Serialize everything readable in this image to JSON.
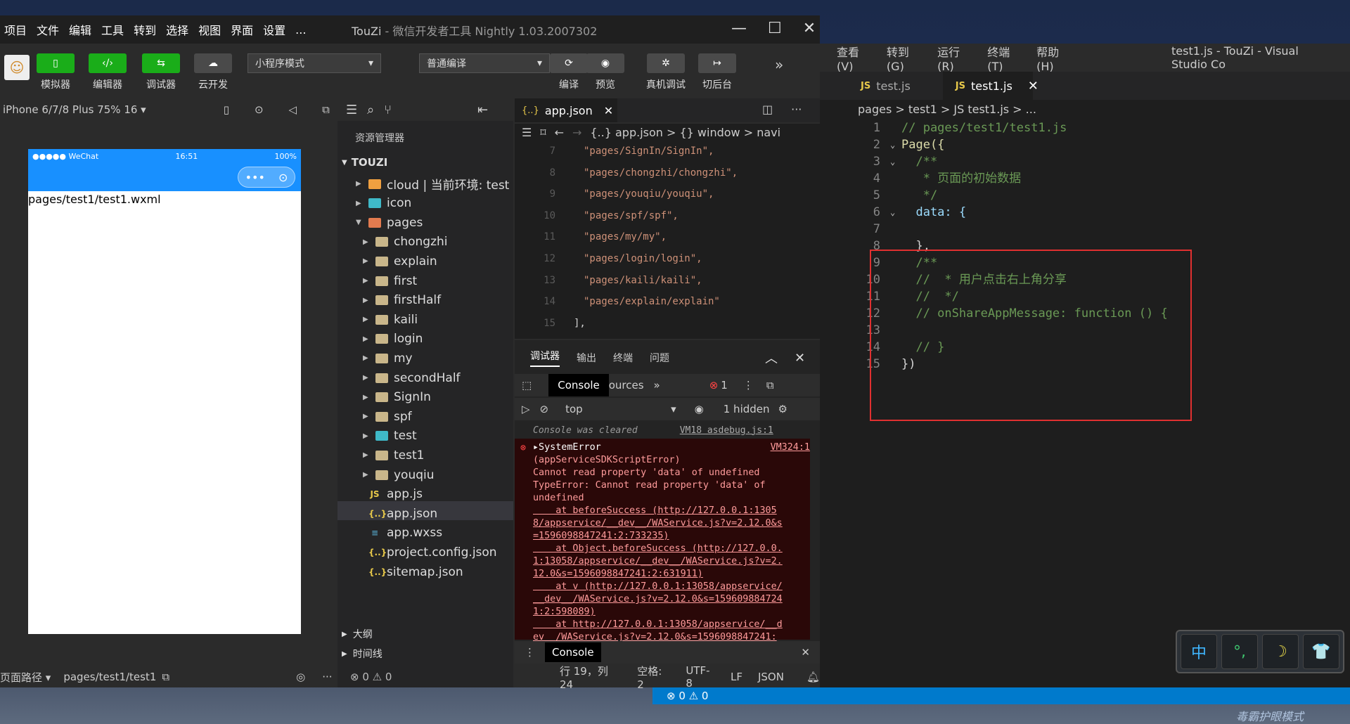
{
  "wx_menu": [
    "项目",
    "文件",
    "编辑",
    "工具",
    "转到",
    "选择",
    "视图",
    "界面",
    "设置",
    "..."
  ],
  "wx_title": {
    "app": "TouZi",
    "sub": " - 微信开发者工具 Nightly 1.03.2007302"
  },
  "toolbar": {
    "simulator": "模拟器",
    "editor": "编辑器",
    "debugger": "调试器",
    "cloud": "云开发",
    "mode": "小程序模式",
    "compile_mode": "普通编译",
    "compile": "编译",
    "preview": "预览",
    "real_debug": "真机调试",
    "backend": "切后台"
  },
  "simulator": {
    "device": "iPhone 6/7/8 Plus 75% 16 ▾",
    "carrier": "●●●●● WeChat",
    "time": "16:51",
    "battery": "100%",
    "page_text": "pages/test1/test1.wxml",
    "footer_label": "页面路径 ▾",
    "footer_path": "pages/test1/test1"
  },
  "explorer": {
    "title": "资源管理器",
    "root": "TOUZI",
    "items": [
      "cloud | 当前环境: test",
      "icon",
      "pages",
      "chongzhi",
      "explain",
      "first",
      "firstHalf",
      "kaili",
      "login",
      "my",
      "secondHalf",
      "SignIn",
      "spf",
      "test",
      "test1",
      "youqiu",
      "app.js",
      "app.json",
      "app.wxss",
      "project.config.json",
      "sitemap.json"
    ],
    "outline": "大纲",
    "timeline": "时间线",
    "status": "⊗ 0 ⚠ 0"
  },
  "editor": {
    "tab": "app.json",
    "crumb": "{..} app.json > {} window > navi",
    "lines": [
      {
        "n": "7",
        "t": "\"pages/SignIn/SignIn\","
      },
      {
        "n": "8",
        "t": "\"pages/chongzhi/chongzhi\","
      },
      {
        "n": "9",
        "t": "\"pages/youqiu/youqiu\","
      },
      {
        "n": "10",
        "t": "\"pages/spf/spf\","
      },
      {
        "n": "11",
        "t": "\"pages/my/my\","
      },
      {
        "n": "12",
        "t": "\"pages/login/login\","
      },
      {
        "n": "13",
        "t": "\"pages/kaili/kaili\","
      },
      {
        "n": "14",
        "t": "\"pages/explain/explain\""
      },
      {
        "n": "15",
        "t": "],"
      }
    ],
    "status": [
      "行 19，列 24",
      "空格: 2",
      "UTF-8",
      "LF",
      "JSON"
    ]
  },
  "debug": {
    "tabs": [
      "调试器",
      "输出",
      "终端",
      "问题"
    ],
    "console": "Console",
    "sources": "Sources",
    "error_count": "1",
    "context": "top",
    "hidden": "1 hidden",
    "cleared": "Console was cleared",
    "cleared_src": "VM18 asdebug.js:1",
    "err_src": "VM324:1",
    "err_lines": [
      "▸SystemError",
      "(appServiceSDKScriptError)",
      "Cannot read property 'data' of undefined",
      "TypeError: Cannot read property 'data' of",
      "undefined",
      "    at beforeSuccess (http://127.0.0.1:1305",
      "8/appservice/__dev__/WAService.js?v=2.12.0&s",
      "=1596098847241:2:733235)",
      "    at Object.beforeSuccess (http://127.0.0.",
      "1:13058/appservice/__dev__/WAService.js?v=2.",
      "12.0&s=1596098847241:2:631911)",
      "    at v (http://127.0.0.1:13058/appservice/",
      "__dev__/WAService.js?v=2.12.0&s=159609884724",
      "1:2:598089)",
      "    at http://127.0.0.1:13058/appservice/__d",
      "ev__/WAService.js?v=2.12.0&s=1596098847241:"
    ],
    "drawer": "Console"
  },
  "vscode": {
    "menu": [
      "查看(V)",
      "转到(G)",
      "运行(R)",
      "终端(T)",
      "帮助(H)"
    ],
    "title": "test1.js - TouZi - Visual Studio Co",
    "tabs": [
      "test.js",
      "test1.js"
    ],
    "crumb": "pages > test1 > JS test1.js > ...",
    "lines": [
      {
        "n": "1",
        "t": "// pages/test1/test1.js",
        "c": "com"
      },
      {
        "n": "2",
        "t": "Page({",
        "c": "fn"
      },
      {
        "n": "3",
        "t": "  /**",
        "c": "com"
      },
      {
        "n": "4",
        "t": "   * 页面的初始数据",
        "c": "com"
      },
      {
        "n": "5",
        "t": "   */",
        "c": "com"
      },
      {
        "n": "6",
        "t": "  data: {",
        "c": "key"
      },
      {
        "n": "7",
        "t": "",
        "c": "plain"
      },
      {
        "n": "8",
        "t": "  },",
        "c": "plain"
      },
      {
        "n": "9",
        "t": "  /**",
        "c": "com"
      },
      {
        "n": "10",
        "t": "  //  * 用户点击右上角分享",
        "c": "com"
      },
      {
        "n": "11",
        "t": "  //  */",
        "c": "com"
      },
      {
        "n": "12",
        "t": "  // onShareAppMessage: function () {",
        "c": "com"
      },
      {
        "n": "13",
        "t": "",
        "c": "plain"
      },
      {
        "n": "14",
        "t": "  // }",
        "c": "com"
      },
      {
        "n": "15",
        "t": "})",
        "c": "plain"
      }
    ],
    "status": "⊗ 0 ⚠ 0"
  },
  "ime": [
    "中",
    "°,",
    "☽",
    "👕"
  ],
  "eye_mode": "毒霸护眼模式"
}
